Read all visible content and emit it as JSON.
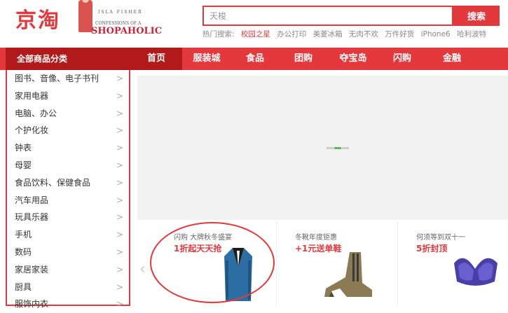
{
  "logo": {
    "text": "京淘"
  },
  "ad": {
    "line1": "ISLA FISHER",
    "line2": "CONFESSIONS OF A",
    "line3": "SHOPAHOLIC"
  },
  "search": {
    "placeholder": "天梭",
    "button_label": "搜索"
  },
  "hot_search": {
    "label": "热门搜索:",
    "items": [
      "校园之星",
      "办公打印",
      "美菱冰箱",
      "无肉不欢",
      "万件好货",
      "iPhone6",
      "哈利波特"
    ]
  },
  "categories_header": "全部商品分类",
  "nav": {
    "items": [
      "首页",
      "服装城",
      "食品",
      "团购",
      "夺宝岛",
      "闪购",
      "金融"
    ]
  },
  "sidebar": {
    "items": [
      "图书、音像、电子书刊",
      "家用电器",
      "电脑、办公",
      "个护化妆",
      "钟表",
      "母婴",
      "食品饮料、保健食品",
      "汽车用品",
      "玩具乐器",
      "手机",
      "数码",
      "家居家装",
      "厨具",
      "服饰内衣"
    ],
    "arrow": ">"
  },
  "promos": [
    {
      "sub": "闪购  大牌秋冬盛宴",
      "title": "1折起天天抢"
    },
    {
      "sub": "冬靴年度钜惠",
      "title": "+1元送单鞋"
    },
    {
      "sub": "何须等到双十一",
      "title": "5折封顶"
    }
  ],
  "colors": {
    "brand": "#e4393c",
    "brand_dark": "#b1191a",
    "carousel_bg": "#f2f2f2"
  }
}
